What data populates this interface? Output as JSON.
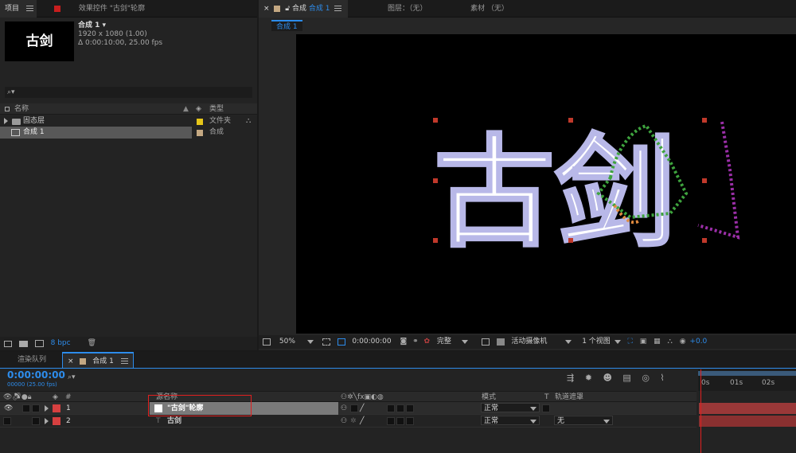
{
  "project_panel": {
    "tab_project": "项目",
    "tab_effects": "效果控件 \"古剑\"轮廓",
    "thumb_text": "古剑",
    "comp_name": "合成 1 ▾",
    "comp_res": "1920 x 1080 (1.00)",
    "comp_dur": "Δ 0:00:10:00, 25.00 fps",
    "search_icon": "⌕▾",
    "col_name": "名称",
    "col_type": "类型",
    "items": [
      {
        "name": "固态层",
        "type": "文件夹",
        "color": "#e6c619"
      },
      {
        "name": "合成 1",
        "type": "合成",
        "color": "#c4a882"
      }
    ],
    "bpc": "8 bpc"
  },
  "comp_panel": {
    "tab_comp_label": "合成",
    "tab_comp_name": "合成 1",
    "tab_layer": "图层：（无）",
    "tab_footage": "素材 （无）",
    "breadcrumb": "合成 1",
    "art_text": "古剑",
    "zoom": "50%",
    "timecode": "0:00:00:00",
    "quality": "完整",
    "camera": "活动摄像机",
    "views": "1 个视图",
    "exposure": "+0.0"
  },
  "timeline_panel": {
    "tab_render": "渲染队列",
    "tab_comp": "合成 1",
    "timecode": "0:00:00:00",
    "frames_fps": "00000 (25.00 fps)",
    "col_index": "#",
    "col_source": "源名称",
    "col_mode": "模式",
    "col_t": "T",
    "col_track": "轨道遮罩",
    "ruler": [
      "0s",
      "01s",
      "02s"
    ],
    "layers": [
      {
        "index": "1",
        "name": "\"古剑\"轮廓",
        "mode": "正常",
        "track": "",
        "color": "#d64040"
      },
      {
        "index": "2",
        "name": "古剑",
        "mode": "正常",
        "track": "无",
        "color": "#d64040"
      }
    ]
  },
  "colors": {
    "accent": "#2d8ceb",
    "highlight_box": "#e02020"
  }
}
